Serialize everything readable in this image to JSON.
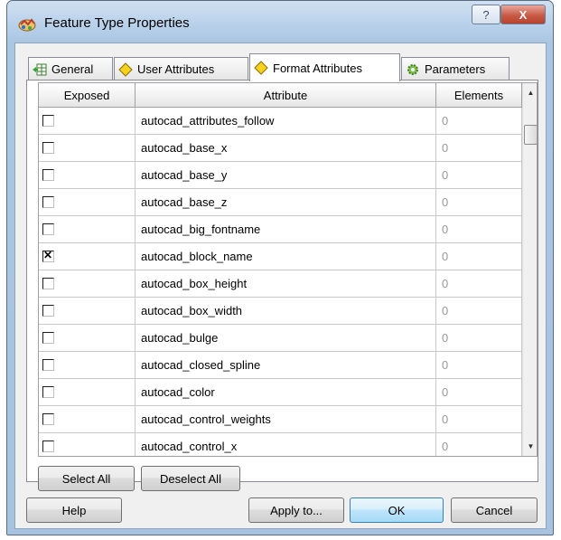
{
  "window": {
    "title": "Feature Type Properties",
    "help_glyph": "?",
    "close_glyph": "X"
  },
  "tabs": [
    {
      "label": "General",
      "icon": "table-arrow-icon"
    },
    {
      "label": "User Attributes",
      "icon": "yellow-diamond-icon"
    },
    {
      "label": "Format Attributes",
      "icon": "yellow-diamond-icon",
      "active": true
    },
    {
      "label": "Parameters",
      "icon": "gear-icon"
    }
  ],
  "table": {
    "headers": {
      "exposed": "Exposed",
      "attribute": "Attribute",
      "elements": "Elements"
    },
    "rows": [
      {
        "exposed": false,
        "attribute": "autocad_attributes_follow",
        "elements": "0"
      },
      {
        "exposed": false,
        "attribute": "autocad_base_x",
        "elements": "0"
      },
      {
        "exposed": false,
        "attribute": "autocad_base_y",
        "elements": "0"
      },
      {
        "exposed": false,
        "attribute": "autocad_base_z",
        "elements": "0"
      },
      {
        "exposed": false,
        "attribute": "autocad_big_fontname",
        "elements": "0"
      },
      {
        "exposed": true,
        "attribute": "autocad_block_name",
        "elements": "0"
      },
      {
        "exposed": false,
        "attribute": "autocad_box_height",
        "elements": "0"
      },
      {
        "exposed": false,
        "attribute": "autocad_box_width",
        "elements": "0"
      },
      {
        "exposed": false,
        "attribute": "autocad_bulge",
        "elements": "0"
      },
      {
        "exposed": false,
        "attribute": "autocad_closed_spline",
        "elements": "0"
      },
      {
        "exposed": false,
        "attribute": "autocad_color",
        "elements": "0"
      },
      {
        "exposed": false,
        "attribute": "autocad_control_weights",
        "elements": "0"
      },
      {
        "exposed": false,
        "attribute": "autocad_control_x",
        "elements": "0"
      }
    ]
  },
  "panel_buttons": {
    "select_all": "Select All",
    "deselect_all": "Deselect All"
  },
  "footer_buttons": {
    "help": "Help",
    "apply_to": "Apply to...",
    "ok": "OK",
    "cancel": "Cancel"
  },
  "colors": {
    "titlebar": "#b9d1ea",
    "close_button": "#c75a46",
    "default_button": "#3c7fb1"
  }
}
